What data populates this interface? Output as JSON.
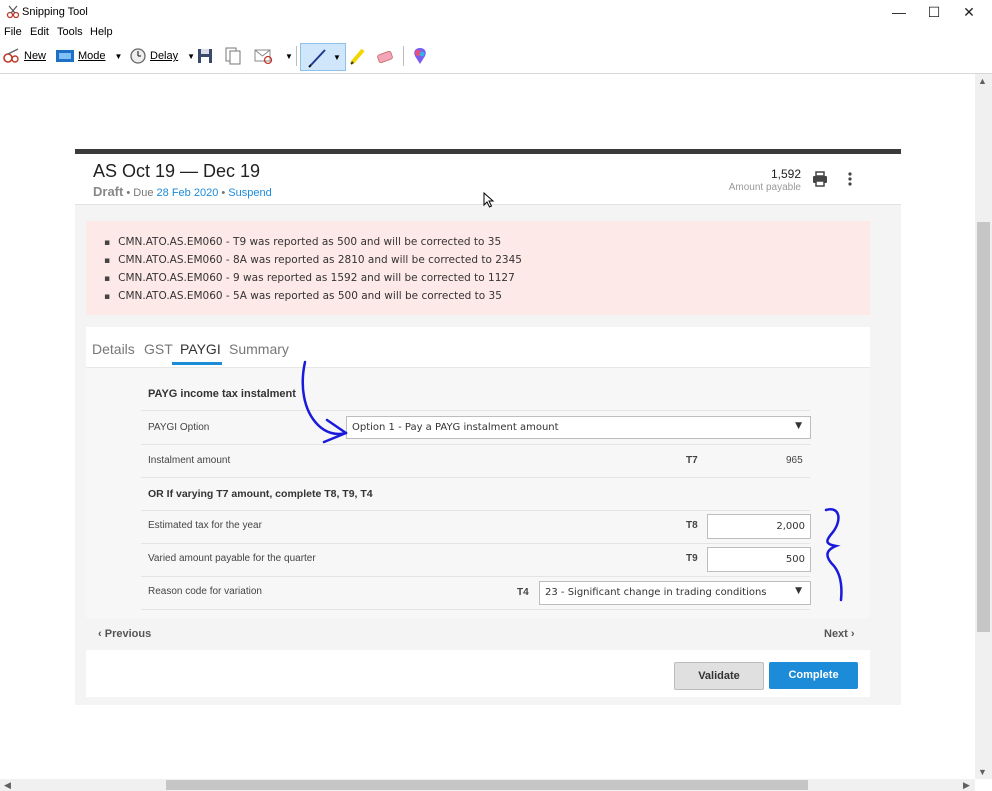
{
  "window": {
    "title": "Snipping Tool",
    "controls": {
      "minimize": "—",
      "maximize": "☐",
      "close": "✕"
    }
  },
  "menu": [
    "File",
    "Edit",
    "Tools",
    "Help"
  ],
  "toolbar": {
    "new_label": "New",
    "mode_label": "Mode",
    "delay_label": "Delay",
    "icons": [
      "new-snip-icon",
      "mode-icon",
      "clock-icon",
      "save-icon",
      "copy-icon",
      "send-email-icon",
      "pen-icon",
      "highlighter-icon",
      "eraser-icon",
      "paint3d-icon"
    ]
  },
  "statement": {
    "title": "AS Oct 19 — Dec 19",
    "status": "Draft",
    "due_prefix": " • Due ",
    "due_date": "28 Feb 2020",
    "separator": " • ",
    "suspend": "Suspend",
    "amount": "1,592",
    "amount_label": "Amount payable"
  },
  "errors": [
    "CMN.ATO.AS.EM060 - T9 was reported as 500 and will be corrected to 35",
    "CMN.ATO.AS.EM060 - 8A was reported as 2810 and will be corrected to 2345",
    "CMN.ATO.AS.EM060 - 9 was reported as 1592 and will be corrected to 1127",
    "CMN.ATO.AS.EM060 - 5A was reported as 500 and will be corrected to 35"
  ],
  "tabs": [
    "Details",
    "GST",
    "PAYGI",
    "Summary"
  ],
  "active_tab": "PAYGI",
  "paygi": {
    "section_title": "PAYG income tax instalment",
    "option_label": "PAYGI Option",
    "option_value": "Option 1 - Pay a PAYG instalment amount",
    "instalment_label": "Instalment amount",
    "instalment_code": "T7",
    "instalment_value": "965",
    "varying_title": "OR If varying T7 amount, complete T8, T9, T4",
    "estimated_label": "Estimated tax for the year",
    "estimated_code": "T8",
    "estimated_value": "2,000",
    "varied_label": "Varied amount payable for the quarter",
    "varied_code": "T9",
    "varied_value": "500",
    "reason_label": "Reason code for variation",
    "reason_code": "T4",
    "reason_value": "23 - Significant change in trading conditions"
  },
  "nav": {
    "previous": "Previous",
    "next": "Next"
  },
  "actions": {
    "validate": "Validate",
    "complete": "Complete"
  },
  "colors": {
    "accent": "#1c8bd8",
    "error_bg": "#fde9e7",
    "annotation_ink": "#1a1adb"
  }
}
